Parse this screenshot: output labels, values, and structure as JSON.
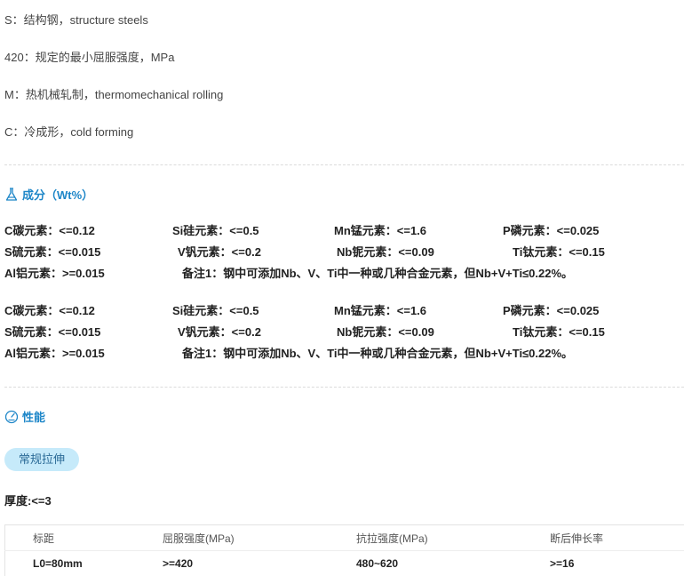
{
  "codes": [
    {
      "text": "S：结构钢，structure steels"
    },
    {
      "text": "420：规定的最小屈服强度，MPa"
    },
    {
      "text": "M：热机械轧制，thermomechanical rolling"
    },
    {
      "text": "C：冷成形，cold forming"
    }
  ],
  "composition": {
    "title": "成分（Wt%）",
    "blocks": [
      {
        "row1": [
          "C碳元素：<=0.12",
          "Si硅元素：<=0.5",
          "Mn锰元素：<=1.6",
          "P磷元素：<=0.025"
        ],
        "row2": [
          "S硫元素：<=0.015",
          "V钒元素：<=0.2",
          "Nb铌元素：<=0.09",
          "Ti钛元素：<=0.15"
        ],
        "row3": [
          "Al铝元素：>=0.015",
          "备注1：钢中可添加Nb、V、Ti中一种或几种合金元素，但Nb+V+Ti≤0.22%。"
        ]
      },
      {
        "row1": [
          "C碳元素：<=0.12",
          "Si硅元素：<=0.5",
          "Mn锰元素：<=1.6",
          "P磷元素：<=0.025"
        ],
        "row2": [
          "S硫元素：<=0.015",
          "V钒元素：<=0.2",
          "Nb铌元素：<=0.09",
          "Ti钛元素：<=0.15"
        ],
        "row3": [
          "Al铝元素：>=0.015",
          "备注1：钢中可添加Nb、V、Ti中一种或几种合金元素，但Nb+V+Ti≤0.22%。"
        ]
      }
    ]
  },
  "performance": {
    "title": "性能",
    "tab_label": "常规拉伸",
    "thickness": "厚度:<=3",
    "table": {
      "headers": [
        "标距",
        "屈服强度(MPa)",
        "抗拉强度(MPa)",
        "断后伸长率"
      ],
      "rows": [
        [
          "L0=80mm",
          ">=420",
          "480~620",
          ">=16"
        ]
      ]
    }
  },
  "colors": {
    "accent": "#1d86c8",
    "pill_bg": "#c6eafa"
  },
  "icons": {
    "composition": "flask-icon",
    "performance": "gauge-icon"
  }
}
